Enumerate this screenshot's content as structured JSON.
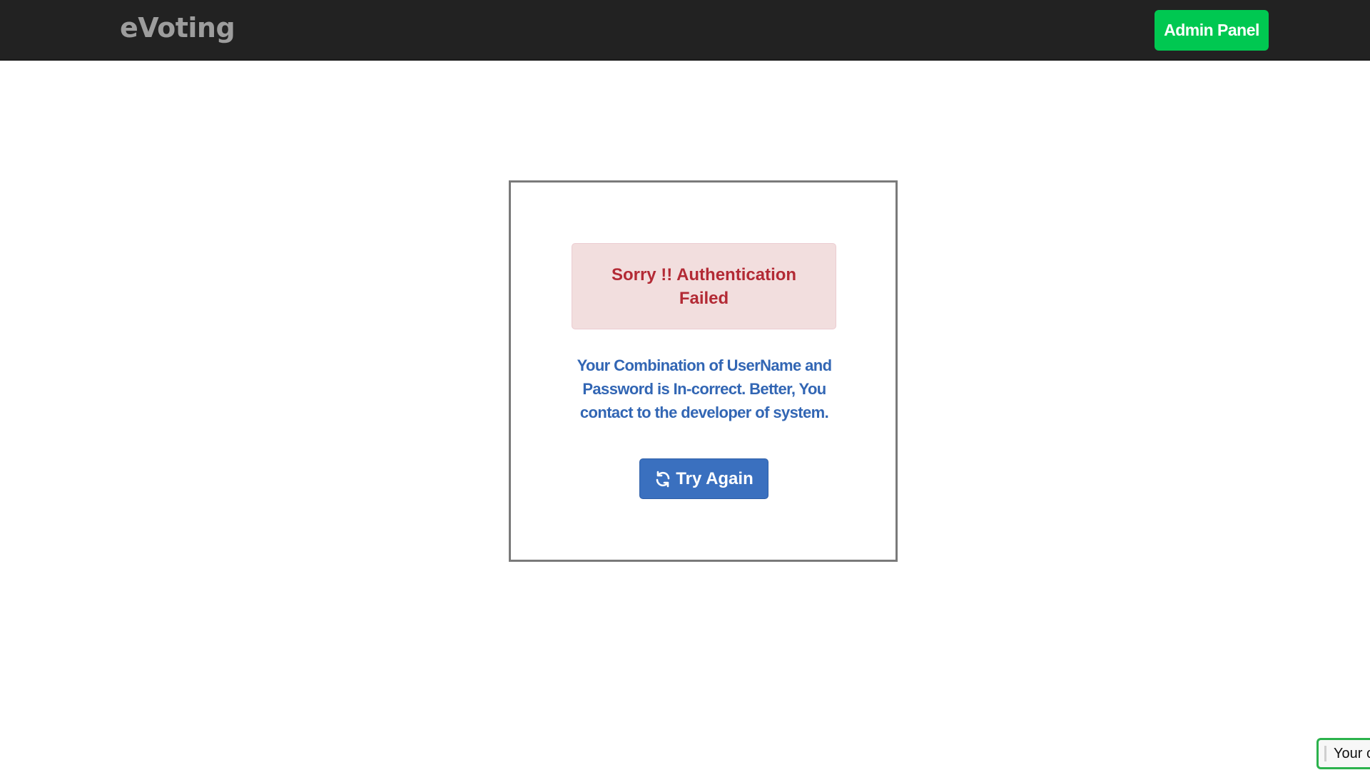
{
  "navbar": {
    "brand": "eVoting",
    "admin_button_label": "Admin Panel",
    "admin_button_color": "#00c851"
  },
  "card": {
    "alert_text": "Sorry !! Authentication Failed",
    "message": "Your Combination of UserName and Password is In-correct. Better, You contact to the developer of system.",
    "try_again_label": "Try Again",
    "try_again_icon": "refresh-icon"
  },
  "toast": {
    "text": "Your c"
  },
  "colors": {
    "navbar_bg": "#222222",
    "alert_bg": "#f2dede",
    "alert_text": "#b32a35",
    "message_text": "#3266b4",
    "primary_button": "#3a70bf"
  }
}
